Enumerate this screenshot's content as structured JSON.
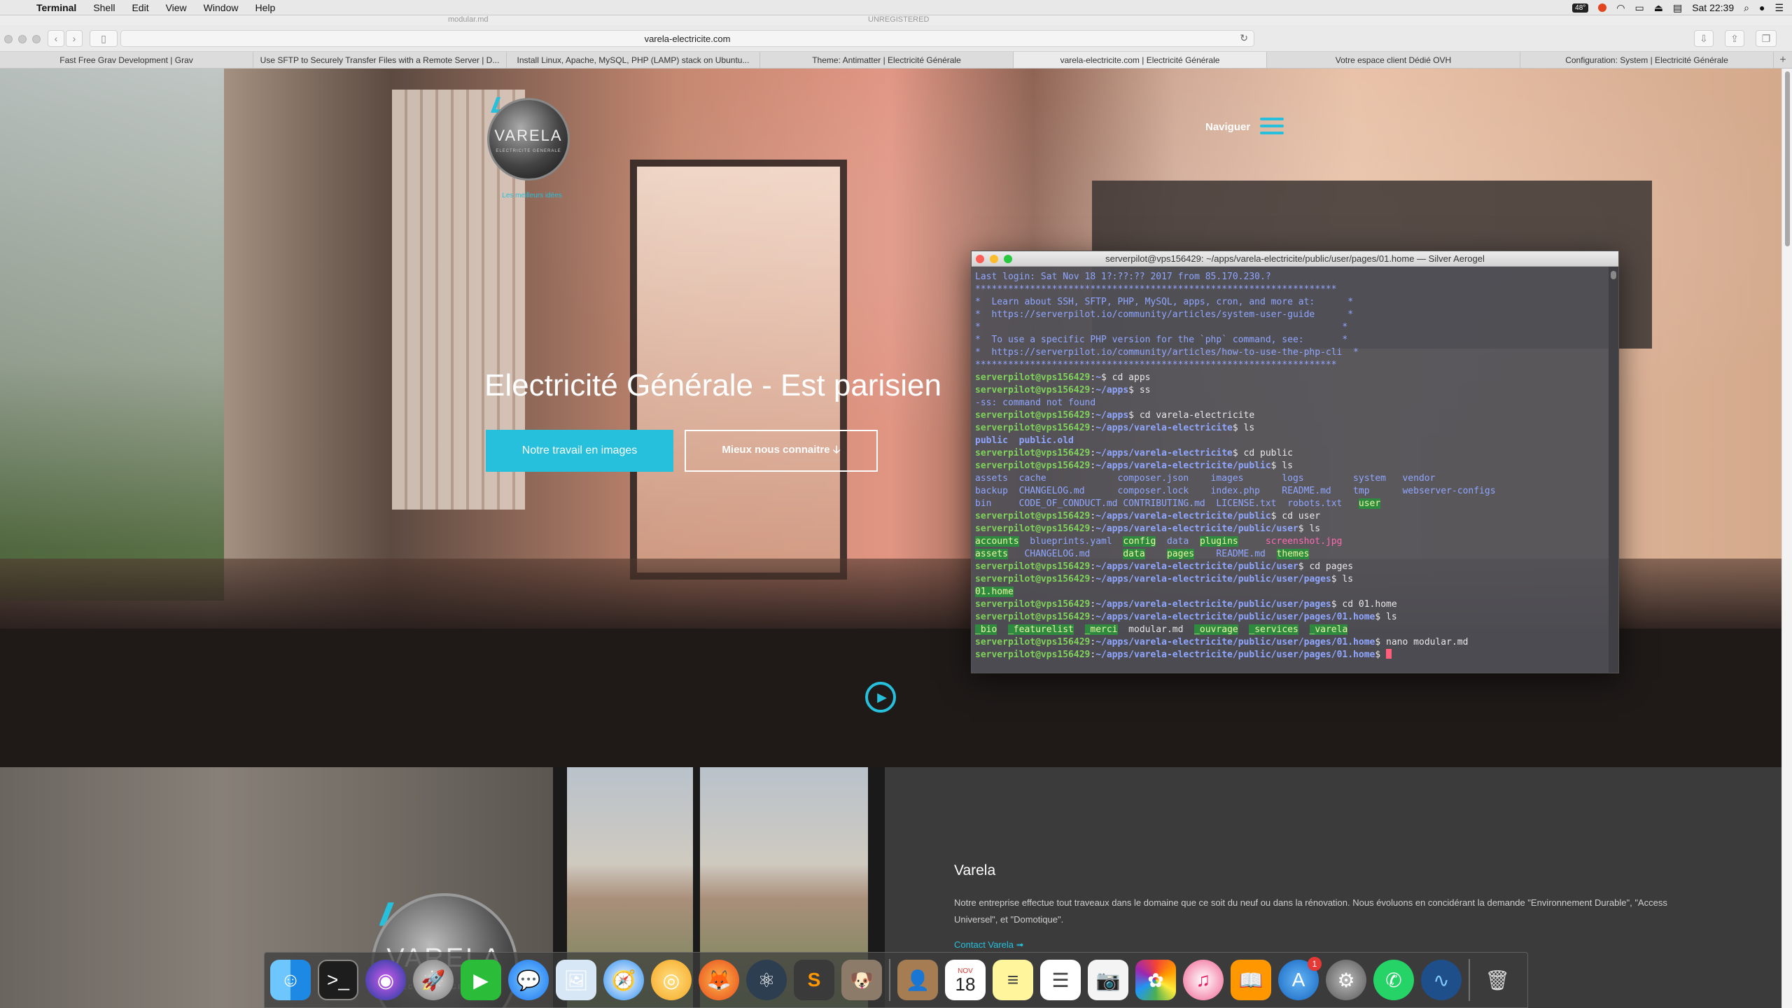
{
  "menubar": {
    "app_name": "Terminal",
    "items": [
      "Shell",
      "Edit",
      "View",
      "Window",
      "Help"
    ],
    "temperature": "48°",
    "clock": "Sat 22:39"
  },
  "window": {
    "title_doc": "modular.md",
    "title_status": "UNREGISTERED"
  },
  "browser": {
    "url": "varela-electricite.com",
    "tabs": [
      "Fast Free Grav Development | Grav",
      "Use SFTP to Securely Transfer Files with a Remote Server | D...",
      "Install Linux, Apache, MySQL, PHP (LAMP) stack on Ubuntu...",
      "Theme: Antimatter | Electricité Générale",
      "varela-electricite.com | Electricité Générale",
      "Votre espace client Dédié OVH",
      "Configuration: System | Electricité Générale"
    ],
    "active_tab": 4
  },
  "site": {
    "logo_text": "VARELA",
    "logo_sub": "ELECTRICITE   GENERALE",
    "logo_tagline": "Les meilleurs idées",
    "nav_label": "Naviguer",
    "hero_title": "Electricité Générale - Est parisien",
    "btn_work": "Notre travail en images",
    "btn_more": "Mieux nous connaitre",
    "about_heading": "Varela",
    "about_text": "Notre entreprise effectue tout traveaux dans le domaine que ce soit du neuf ou dans la rénovation. Nous évoluons en concidérant la demande \"Environnement Durable\", \"Access Universel\", et \"Domotique\".",
    "about_link": "Contact Varela ➟"
  },
  "terminal": {
    "title": "serverpilot@vps156429: ~/apps/varela-electricite/public/user/pages/01.home — Silver Aerogel",
    "login": "Last login: Sat Nov 18 1?:??:?? 2017 from 85.170.230.?",
    "banner": [
      "******************************************************************",
      "*  Learn about SSH, SFTP, PHP, MySQL, apps, cron, and more at:      *",
      "*  https://serverpilot.io/community/articles/system-user-guide      *",
      "*                                                                  *",
      "*  To use a specific PHP version for the `php` command, see:       *",
      "*  https://serverpilot.io/community/articles/how-to-use-the-php-cli  *",
      "******************************************************************"
    ],
    "prompt_user": "serverpilot@vps156429",
    "paths": {
      "home": "~",
      "apps": "~/apps",
      "varela": "~/apps/varela-electricite",
      "public": "~/apps/varela-electricite/public",
      "user": "~/apps/varela-electricite/public/user",
      "pages": "~/apps/varela-electricite/public/user/pages",
      "home01": "~/apps/varela-electricite/public/user/pages/01.home"
    },
    "cmds": {
      "c1": "$ cd apps",
      "c2": "$ ss",
      "c3": "$ cd varela-electricite",
      "c4": "$ ls",
      "c5": "$ cd public",
      "c6": "$ ls",
      "c7": "$ cd user",
      "c8": "$ ls",
      "c9": "$ cd pages",
      "c10": "$ ls",
      "c11": "$ cd 01.home",
      "c12": "$ ls",
      "c13": "$ nano modular.md",
      "c14": "$ "
    },
    "err": "-ss: command not found",
    "ls_varela": "public  public.old",
    "ls_public": {
      "r1": "assets  cache             composer.json    images       logs         system   vendor",
      "r2": "backup  CHANGELOG.md      composer.lock    index.php    README.md    tmp      webserver-configs",
      "r3a": "bin     CODE_OF_CONDUCT.md CONTRIBUTING.md  LICENSE.txt  robots.txt   ",
      "r3b": "user"
    },
    "ls_user": {
      "r1a": "accounts",
      "r1b": "  blueprints.yaml  ",
      "r1c": "config",
      "r1d": "  data  ",
      "r1e": "plugins",
      "r1f": "     screenshot.jpg",
      "r2a": "assets",
      "r2b": "   CHANGELOG.md      ",
      "r2c": "data",
      "r2d": "    ",
      "r2e": "pages",
      "r2f": "    README.md  ",
      "r2g": "themes"
    },
    "ls_pages": "01.home",
    "ls_home": {
      "a": "_bio",
      "b": "_featurelist",
      "c": "_merci",
      "d": "modular.md",
      "e": "_ouvrage",
      "f": "_services",
      "g": "_varela"
    }
  },
  "dock": {
    "calendar_month": "NOV",
    "calendar_day": "18",
    "appstore_badge": "1",
    "apps": [
      "finder-icon",
      "terminal-icon",
      "siri-icon",
      "launchpad-icon",
      "facetime-icon",
      "messages-icon",
      "preview-icon",
      "safari-icon",
      "chrome-canary-icon",
      "firefox-icon",
      "atom-icon",
      "sublime-icon",
      "gimp-icon",
      "contacts-icon",
      "calendar-icon",
      "notes-icon",
      "reminders-icon",
      "photo-booth-icon",
      "photos-icon",
      "itunes-icon",
      "ibooks-icon",
      "app-store-icon",
      "system-preferences-icon",
      "whatsapp-icon",
      "dolphin-icon",
      "trash-icon"
    ]
  }
}
